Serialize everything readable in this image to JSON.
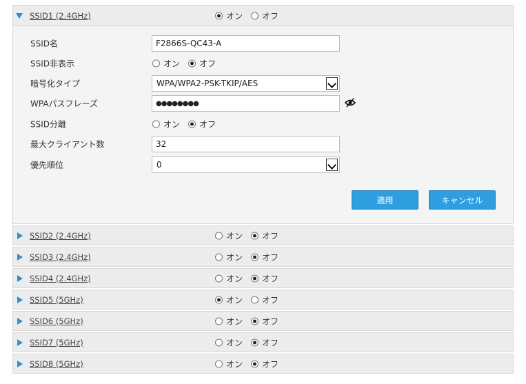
{
  "radio_on": "オン",
  "radio_off": "オフ",
  "ssid1": {
    "title": "SSID1 (2.4GHz)",
    "enabled": "on",
    "fields": {
      "ssid_name": {
        "label": "SSID名",
        "value": "F2866S-QC43-A"
      },
      "ssid_hide": {
        "label": "SSID非表示",
        "selected": "off"
      },
      "encryption": {
        "label": "暗号化タイプ",
        "value": "WPA/WPA2-PSK-TKIP/AES"
      },
      "passphrase": {
        "label": "WPAパスフレーズ",
        "value": "●●●●●●●●"
      },
      "isolation": {
        "label": "SSID分離",
        "selected": "off"
      },
      "max_clients": {
        "label": "最大クライアント数",
        "value": "32"
      },
      "priority": {
        "label": "優先順位",
        "value": "0"
      }
    },
    "apply_label": "適用",
    "cancel_label": "キャンセル"
  },
  "collapsed_ssids": [
    {
      "title": "SSID2 (2.4GHz)",
      "enabled": "off"
    },
    {
      "title": "SSID3 (2.4GHz)",
      "enabled": "off"
    },
    {
      "title": "SSID4 (2.4GHz)",
      "enabled": "off"
    },
    {
      "title": "SSID5 (5GHz)",
      "enabled": "on"
    },
    {
      "title": "SSID6 (5GHz)",
      "enabled": "off"
    },
    {
      "title": "SSID7 (5GHz)",
      "enabled": "off"
    },
    {
      "title": "SSID8 (5GHz)",
      "enabled": "off"
    }
  ],
  "colors": {
    "accent": "#2f9ee0",
    "header_bg": "#ececec",
    "body_bg": "#f4f4f4"
  }
}
